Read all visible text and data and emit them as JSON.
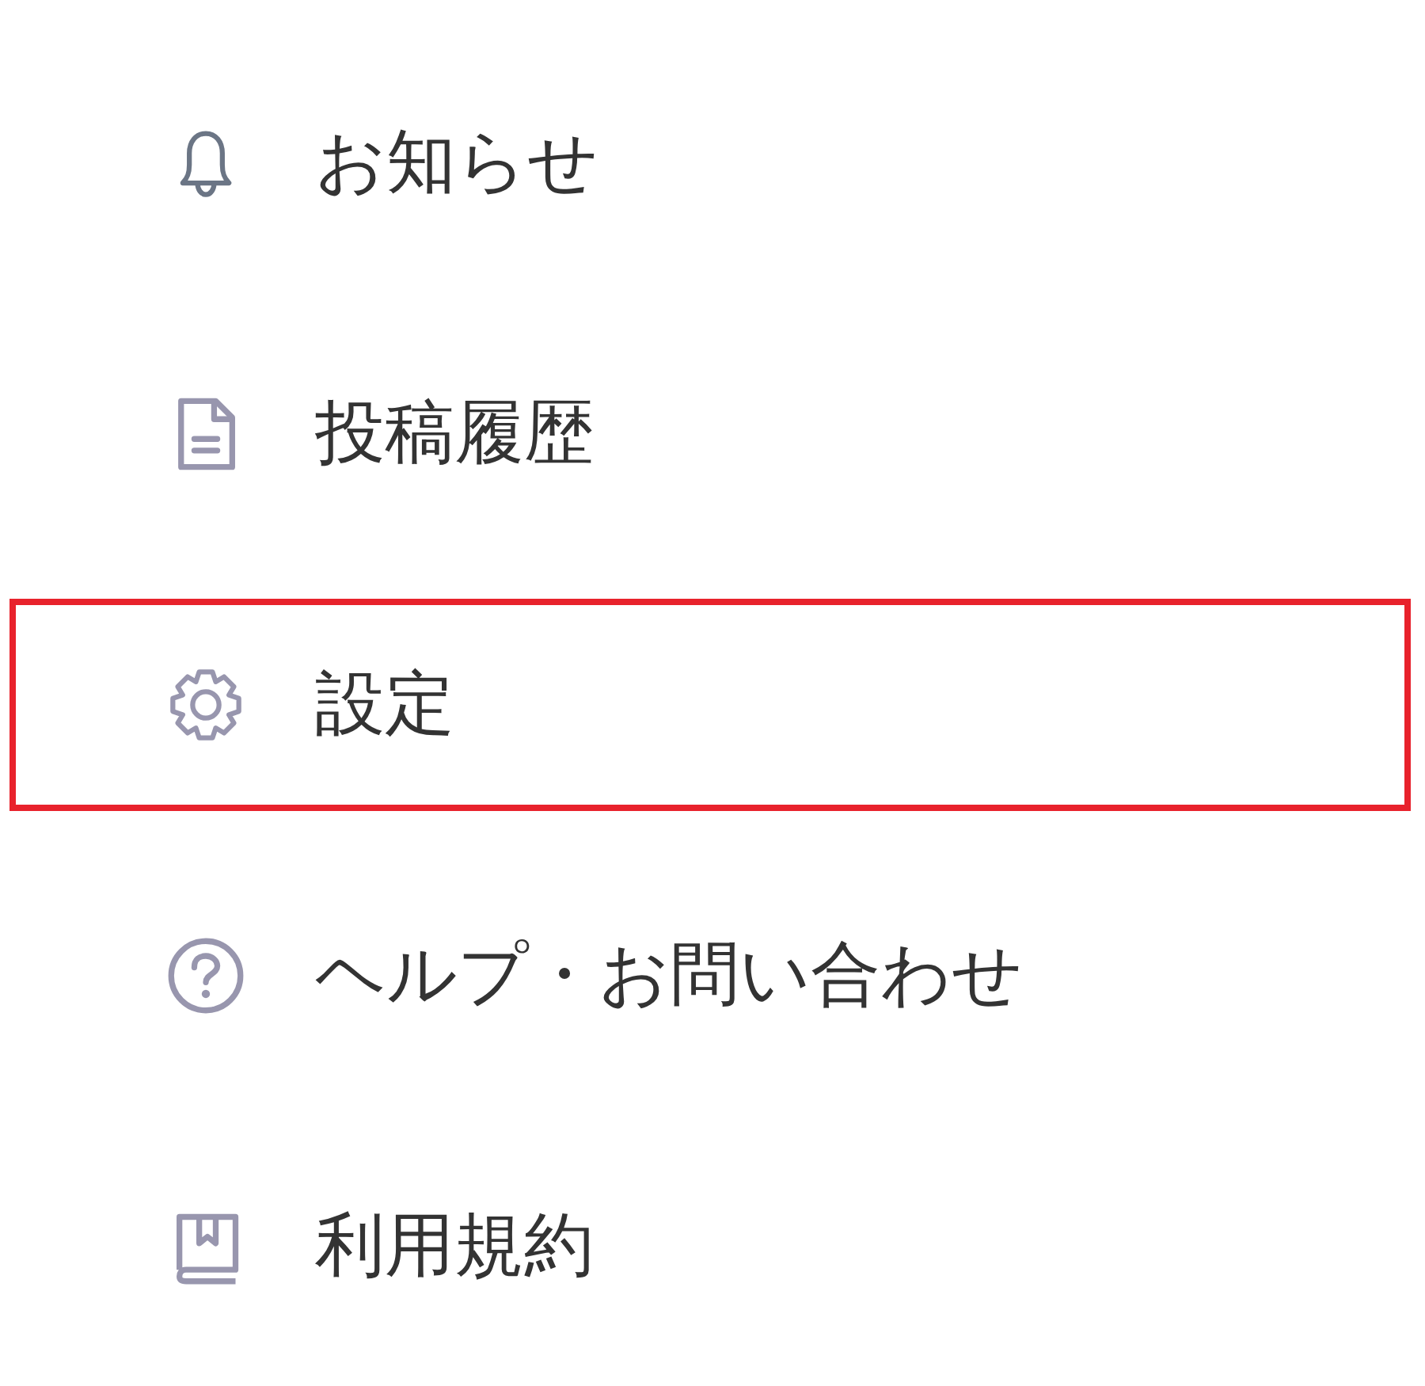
{
  "menu": {
    "items": [
      {
        "label": "お知らせ",
        "highlighted": false
      },
      {
        "label": "投稿履歴",
        "highlighted": false
      },
      {
        "label": "設定",
        "highlighted": true
      },
      {
        "label": "ヘルプ・お問い合わせ",
        "highlighted": false
      },
      {
        "label": "利用規約",
        "highlighted": false
      }
    ]
  }
}
